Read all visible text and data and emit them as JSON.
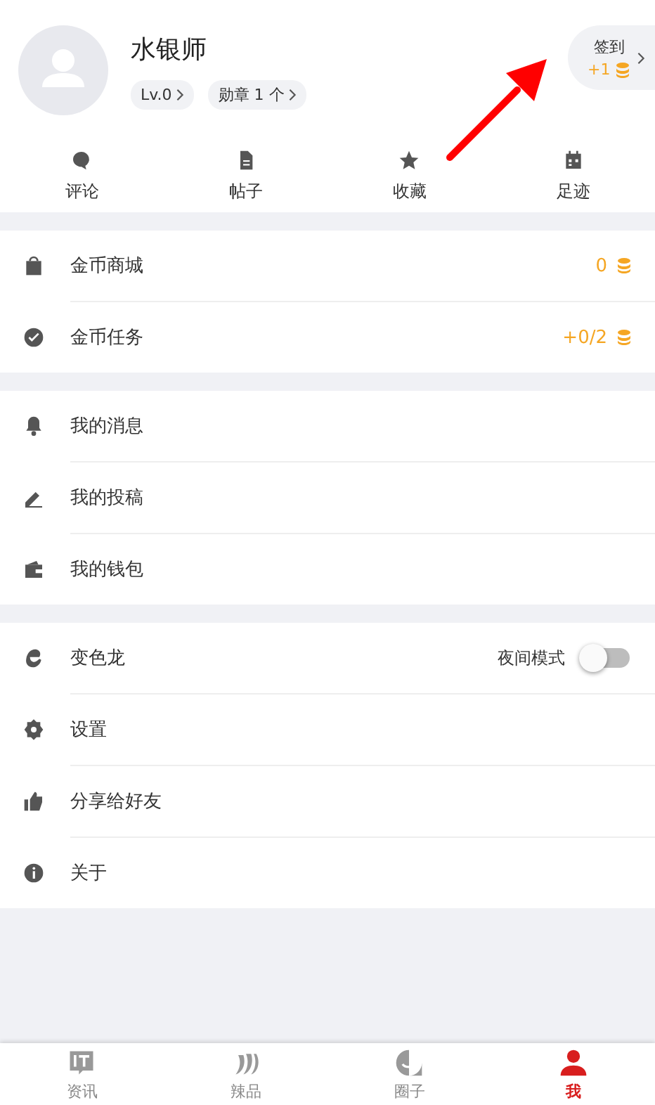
{
  "profile": {
    "name": "水银师",
    "badges": [
      "Lv.0",
      "勋章 1 个"
    ]
  },
  "checkin": {
    "label": "签到",
    "reward": "+1"
  },
  "quick_actions": [
    {
      "kind": "comment",
      "label": "评论"
    },
    {
      "kind": "post",
      "label": "帖子"
    },
    {
      "kind": "favorite",
      "label": "收藏"
    },
    {
      "kind": "history",
      "label": "足迹"
    }
  ],
  "sections": [
    {
      "rows": [
        {
          "kind": "shop",
          "label": "金币商城",
          "value": "0"
        },
        {
          "kind": "task",
          "label": "金币任务",
          "value": "+0/2"
        }
      ]
    },
    {
      "rows": [
        {
          "kind": "bell",
          "label": "我的消息"
        },
        {
          "kind": "pen",
          "label": "我的投稿"
        },
        {
          "kind": "wallet",
          "label": "我的钱包"
        }
      ]
    },
    {
      "rows": [
        {
          "kind": "theme",
          "label": "变色龙",
          "toggle_label": "夜间模式",
          "on": false
        },
        {
          "kind": "gear",
          "label": "设置"
        },
        {
          "kind": "like",
          "label": "分享给好友"
        },
        {
          "kind": "info",
          "label": "关于"
        }
      ]
    }
  ],
  "tabs": [
    {
      "kind": "news",
      "label": "资讯",
      "selected": false
    },
    {
      "kind": "chili",
      "label": "辣品",
      "selected": false
    },
    {
      "kind": "circle",
      "label": "圈子",
      "selected": false
    },
    {
      "kind": "me",
      "label": "我",
      "selected": true
    }
  ]
}
